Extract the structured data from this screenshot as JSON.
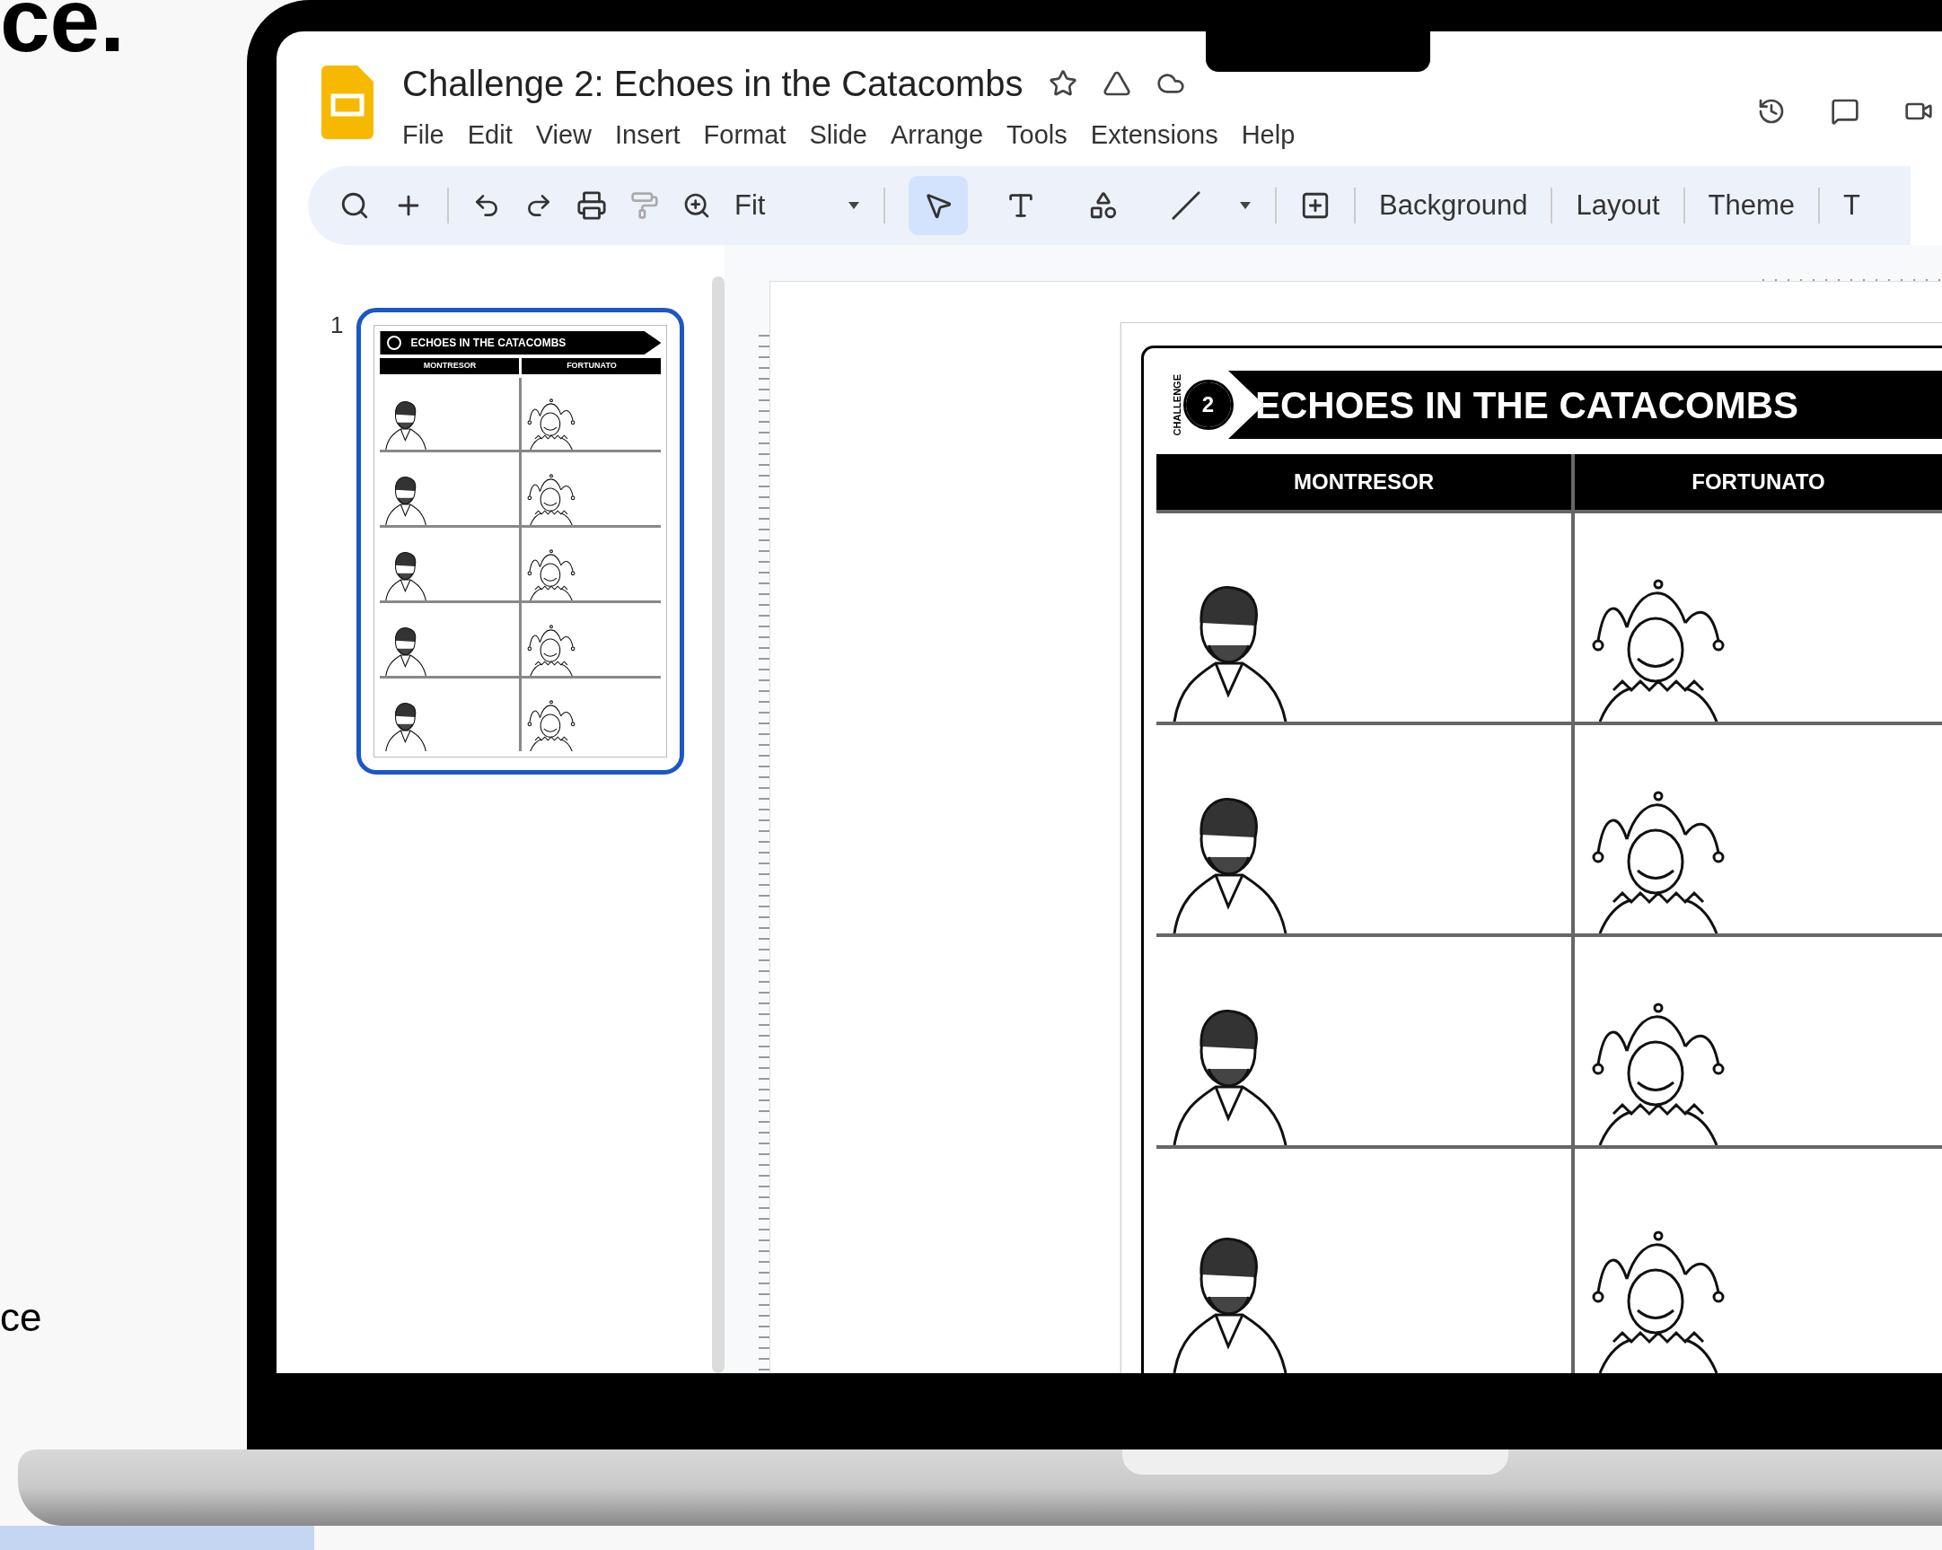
{
  "page_text": {
    "heading_fragment": "ce.",
    "line_fragment": "ce"
  },
  "app": {
    "title": "Challenge 2: Echoes in the Catacombs",
    "menu": [
      "File",
      "Edit",
      "View",
      "Insert",
      "Format",
      "Slide",
      "Arrange",
      "Tools",
      "Extensions",
      "Help"
    ],
    "zoom": "Fit",
    "tools": [
      {
        "selected": true
      },
      {
        "selected": false
      },
      {
        "selected": false
      },
      {
        "selected": false
      }
    ],
    "toolbar_buttons": [
      "Background",
      "Layout",
      "Theme",
      "T"
    ]
  },
  "slides": [
    {
      "number": "1",
      "selected": true,
      "title": "ECHOES IN THE CATACOMBS",
      "columns": [
        "MONTRESOR",
        "FORTUNATO"
      ]
    }
  ],
  "slide": {
    "badge": "2",
    "arc_label": "CHALLENGE",
    "title": "ECHOES IN THE CATACOMBS",
    "columns": [
      "MONTRESOR",
      "FORTUNATO"
    ]
  }
}
